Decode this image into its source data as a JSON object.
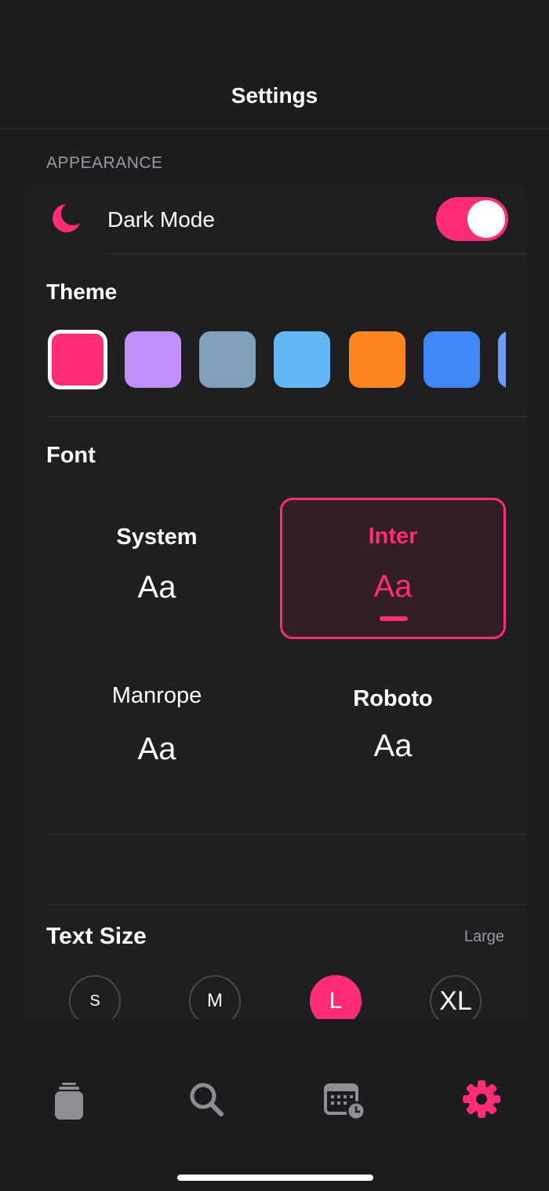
{
  "header": {
    "title": "Settings"
  },
  "appearance": {
    "section_label": "APPEARANCE",
    "dark_mode": {
      "label": "Dark Mode",
      "enabled": true,
      "icon": "moon-icon"
    },
    "theme": {
      "title": "Theme",
      "selected_index": 0,
      "swatches": [
        "#ff2d78",
        "#c08ff7",
        "#7f9fbb",
        "#64b7f6",
        "#fe851f",
        "#4386f5",
        "#6f9cf2"
      ]
    },
    "font": {
      "title": "Font",
      "selected": "Inter",
      "options": [
        {
          "name": "System",
          "sample": "Aa"
        },
        {
          "name": "Inter",
          "sample": "Aa"
        },
        {
          "name": "Manrope",
          "sample": "Aa"
        },
        {
          "name": "Roboto",
          "sample": "Aa"
        }
      ]
    },
    "text_size": {
      "title": "Text Size",
      "value": "Large",
      "options": [
        "S",
        "M",
        "L",
        "XL"
      ],
      "selected": "L"
    }
  },
  "tabbar": {
    "tabs": [
      {
        "icon": "stack-icon",
        "active": false
      },
      {
        "icon": "search-icon",
        "active": false
      },
      {
        "icon": "calendar-clock-icon",
        "active": false
      },
      {
        "icon": "gear-icon",
        "active": true
      }
    ]
  },
  "colors": {
    "accent": "#ff2d78",
    "background": "#1c1c1e",
    "inactive_icon": "#8e8e93"
  }
}
